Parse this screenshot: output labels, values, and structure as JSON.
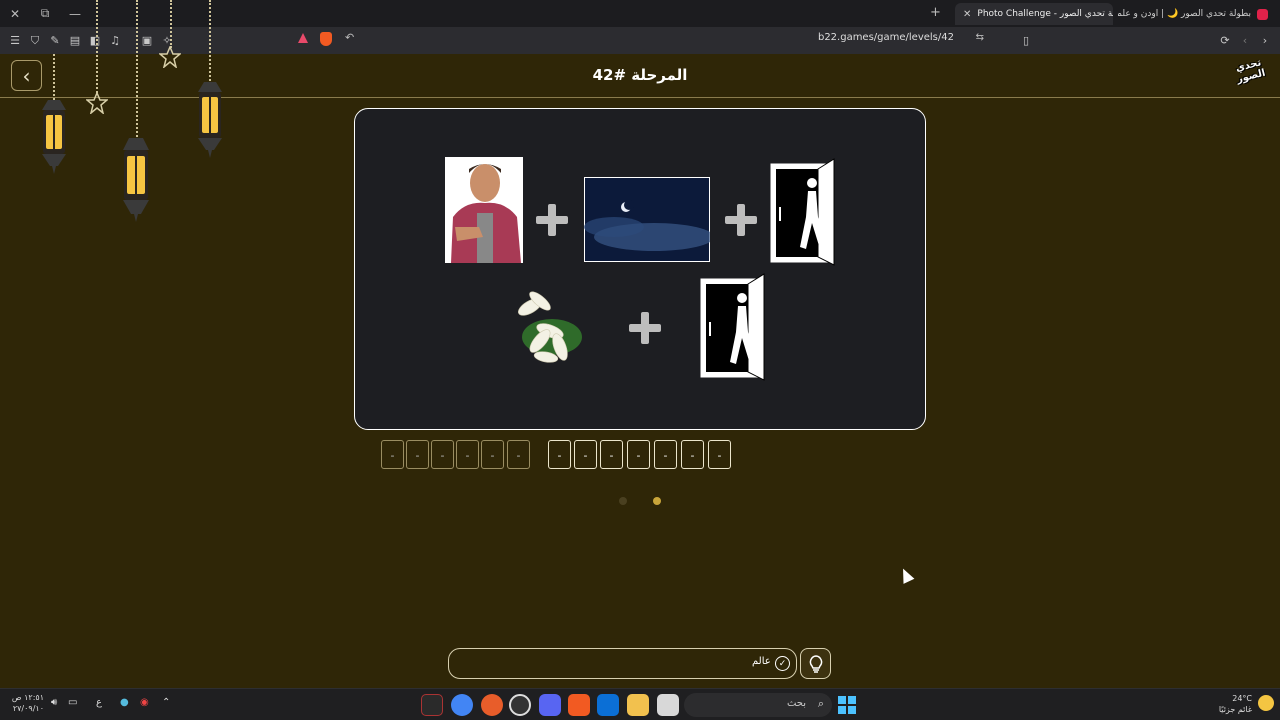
{
  "browser": {
    "tabs": [
      {
        "title": "(2) بطولة تحدي الصور 🌙 | اودن و علما",
        "favicon_color": "#e0224a"
      },
      {
        "title": "Photo Challenge - لعبة تحدي الصور",
        "favicon_color": "#f4d35e"
      }
    ],
    "url": "b22.games/game/levels/42",
    "window_close": "✕",
    "window_restore": "⧉",
    "window_min": "—",
    "new_tab": "+"
  },
  "game": {
    "title": "المرحلة #42",
    "logo_text": "تحدي الصور",
    "back_label": "‹",
    "colors": {
      "background": "#2f2607",
      "card": "#1d1e22",
      "accent": "#c9a53a"
    },
    "puzzle_images": [
      "man pointing",
      "night sky with crescent moon",
      "person exiting door",
      "white lilies",
      "person exiting door"
    ],
    "answer": {
      "word1": [
        "-",
        "-",
        "-",
        "-",
        "-",
        "-"
      ],
      "word2": [
        "-",
        "-",
        "-",
        "-",
        "-",
        "-",
        "-"
      ]
    },
    "pagination_active": 2,
    "input_hint": "عالم",
    "hint_check": "✓"
  },
  "taskbar": {
    "clock_time": "١٢:٥١ ص",
    "clock_date": "٢٧/٠٩/١٠",
    "lang": "ع",
    "search_placeholder": "بحث",
    "weather_temp": "24°C",
    "weather_desc": "غائم جزئيًا"
  }
}
